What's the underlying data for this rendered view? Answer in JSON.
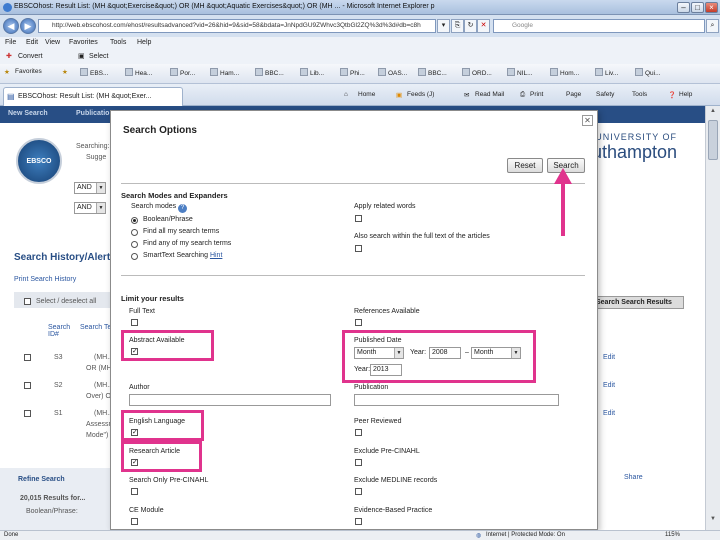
{
  "window": {
    "title": "EBSCOhost: Result List: (MH &quot;Exercise&quot;) OR (MH &quot;Aquatic Exercises&quot;) OR (MH ... - Microsoft Internet Explorer p",
    "address": "http://web.ebscohost.com/ehost/resultsadvanced?vid=26&hid=9&sid=58&bdata=JnNpdGU9ZWhvc3QtbGl2ZQ%3d%3d#db=c8h",
    "search_placeholder": "Google"
  },
  "menu": [
    "File",
    "Edit",
    "View",
    "Favorites",
    "Tools",
    "Help"
  ],
  "convert": {
    "convert_label": "Convert",
    "select_label": "Select"
  },
  "favorites": {
    "label": "Favorites",
    "items": [
      "EBS...",
      "Hea...",
      "Por...",
      "Ham...",
      "BBC...",
      "Lib...",
      "Phi...",
      "OAS...",
      "BBC...",
      "ORD...",
      "NIL...",
      "Hom...",
      "Liv...",
      "Qui..."
    ]
  },
  "tab": {
    "label": "EBSCOhost: Result List: (MH &quot;Exer..."
  },
  "commands": [
    "Home",
    "Feeds (J)",
    "Read Mail",
    "Print",
    "Page",
    "Safety",
    "Tools",
    "Help"
  ],
  "page": {
    "nav": [
      "New Search",
      "Publications"
    ],
    "logo": "EBSCO",
    "searching": "Searching:",
    "suggest": "Sugge",
    "and1": "AND",
    "and2": "AND",
    "history_title": "Search History/Alerts",
    "print_history": "Print Search History",
    "select_all": "Select / deselect all",
    "search_id": "Search ID#",
    "search_terms": "Search Terms",
    "rows": [
      {
        "id": "S3",
        "text": "(MH..."
      },
      {
        "id": "S2",
        "text": "(MH..."
      },
      {
        "id": "S1",
        "text": "(MH..."
      }
    ],
    "row_sub": [
      "OR (MH",
      "Over) O",
      "Assessm",
      "Mode\") O"
    ],
    "uni_top": "UNIVERSITY OF",
    "uni_name": "uthampton",
    "search_results_btn": "Search Search Results",
    "edit": "Edit",
    "refine": "Refine Search",
    "results_count": "20,015 Results for...",
    "boolean": "Boolean/Phrase:",
    "share": "Share"
  },
  "modal": {
    "title": "Search Options",
    "reset": "Reset",
    "search": "Search",
    "modes_section": "Search Modes and Expanders",
    "search_modes_label": "Search modes",
    "modes": [
      {
        "label": "Boolean/Phrase",
        "selected": true
      },
      {
        "label": "Find all my search terms",
        "selected": false
      },
      {
        "label": "Find any of my search terms",
        "selected": false
      },
      {
        "label": "SmartText Searching",
        "selected": false
      }
    ],
    "hint": "Hint",
    "apply_related": "Apply related words",
    "also_fulltext": "Also search within the full text of the articles",
    "limit_section": "Limit your results",
    "full_text": "Full Text",
    "references": "References Available",
    "abstract": "Abstract Available",
    "abstract_checked": true,
    "published_date": "Published Date",
    "month": "Month",
    "year_label": "Year:",
    "year_from": "2008",
    "month2": "Month",
    "year2_label": "Year:",
    "year_to": "2013",
    "author": "Author",
    "publication": "Publication",
    "english": "English Language",
    "english_checked": true,
    "peer": "Peer Reviewed",
    "research": "Research Article",
    "research_checked": true,
    "exclude_pre_cinahl": "Exclude Pre-CINAHL",
    "search_only_pre": "Search Only Pre-CINAHL",
    "exclude_medline": "Exclude MEDLINE records",
    "ce_module": "CE Module",
    "evidence": "Evidence-Based Practice"
  },
  "status": {
    "left": "Done",
    "zone": "Internet | Protected Mode: On",
    "zoom": "115%"
  },
  "colors": {
    "highlight": "#e0338d",
    "ebsco_blue": "#284e85"
  }
}
